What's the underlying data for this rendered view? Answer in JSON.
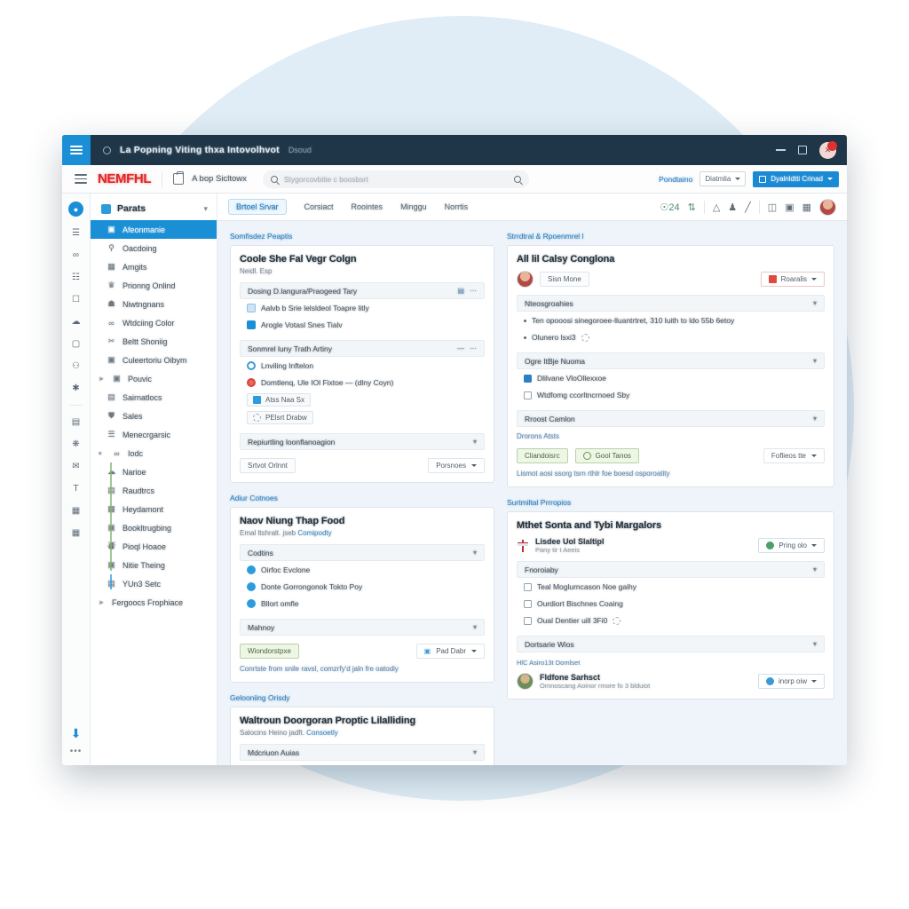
{
  "titlebar": {
    "title": "La Popning Viting thxa Intovolhvot",
    "subtitle": "Dsoud",
    "app_icon": "hamburger-icon",
    "status_icon": "record-circle-icon",
    "minimize": "minimize-icon",
    "maximize": "maximize-icon",
    "close": "close-icon"
  },
  "appbar": {
    "logo": "NEMFHL",
    "menu_icon": "hamburger-icon",
    "briefcase_icon": "briefcase-icon",
    "app_selector_label": "A bop Sicltowx",
    "search": {
      "placeholder": "Stygorcovbitie c boosbsrt",
      "icon": "search-icon"
    },
    "right_link": "Pondtaino",
    "right_select": "Diatmlia",
    "primary_button": "Dyalnldtti Crinad",
    "primary_icon": "save-icon"
  },
  "rail": {
    "top_icon": "user-circle-icon",
    "icons": [
      "list-icon",
      "share-icon",
      "image-icon",
      "inbox-icon",
      "cloud-icon",
      "note-icon",
      "mic-icon",
      "cut-icon"
    ],
    "icons2": [
      "printer-icon",
      "settings-icon",
      "message-icon",
      "text-icon",
      "page-icon",
      "grid-icon"
    ],
    "bottom_icons": [
      "download-icon",
      "more-icon"
    ]
  },
  "sidebar": {
    "header": {
      "label": "Parats",
      "chevron": "chevron-down-icon",
      "icon": "folder-icon"
    },
    "items": [
      {
        "label": "Afeonmanie",
        "icon": "bag-icon",
        "active": true,
        "indent": 1
      },
      {
        "label": "Oacdoing",
        "icon": "search-icon",
        "active": false,
        "indent": 1
      },
      {
        "label": "Amgits",
        "icon": "chart-icon",
        "active": false,
        "indent": 1
      },
      {
        "label": "Prionng Onlind",
        "icon": "award-icon",
        "active": false,
        "indent": 1
      },
      {
        "label": "Niwtngnans",
        "icon": "bank-icon",
        "active": false,
        "indent": 1
      },
      {
        "label": "Wtdciing Color",
        "icon": "share-icon",
        "active": false,
        "indent": 1
      },
      {
        "label": "Beltt Shoniig",
        "icon": "scissors-icon",
        "active": false,
        "indent": 1
      },
      {
        "label": "Culeertoriu Oibym",
        "icon": "image-icon",
        "active": false,
        "indent": 1
      },
      {
        "label": "Pouvic",
        "icon": "calendar-icon",
        "active": false,
        "indent": 0
      },
      {
        "label": "Sairnatlocs",
        "icon": "doc-icon",
        "active": false,
        "indent": 1
      },
      {
        "label": "Sales",
        "icon": "user-icon",
        "active": false,
        "indent": 1
      },
      {
        "label": "Menecrgarsic",
        "icon": "layers-icon",
        "active": false,
        "indent": 1
      }
    ],
    "group": {
      "label": "Iodc",
      "icon": "share-icon",
      "chevron": "chevron-down-icon",
      "children": [
        {
          "label": "Narioe",
          "icon": "globe-icon"
        },
        {
          "label": "Raudtrcs",
          "icon": "book-icon"
        },
        {
          "label": "Heydamont",
          "icon": "table-icon"
        },
        {
          "label": "Bookltrugbing",
          "icon": "note-icon"
        },
        {
          "label": "Pioql Hoaoe",
          "icon": "tag-icon"
        },
        {
          "label": "Nitie Theing",
          "icon": "calendar-icon"
        },
        {
          "label": "YUn3 Setc",
          "icon": "book-icon"
        }
      ]
    },
    "footer_item": {
      "label": "Fergoocs Frophiace",
      "icon": "chevron-right-icon"
    }
  },
  "tabbar": {
    "tabs": [
      {
        "label": "Brtoel Srvar",
        "selected": true
      },
      {
        "label": "Corsiact",
        "selected": false
      },
      {
        "label": "Roointes",
        "selected": false
      },
      {
        "label": "Minggu",
        "selected": false
      },
      {
        "label": "Norrtis",
        "selected": false
      }
    ],
    "tools": [
      "share-count-icon",
      "sync-icon",
      "triangle-icon",
      "person-icon",
      "pencil-icon",
      "crop-icon",
      "export-icon",
      "expand-icon"
    ],
    "avatar": "user-avatar"
  },
  "left_column": [
    {
      "section_title": "Somfisdez Peaptis",
      "title": "Coole She Fal Vegr Colgn",
      "subtitle": "Neidl. Esp",
      "accordion1": {
        "label": "Dosing D.langura/Praogeed Tary",
        "icons": [
          "blue-badge-icon",
          "more-icon"
        ]
      },
      "rows1": [
        {
          "label": "Aalvb b Srie lelsldeol Toapre litly",
          "icon": "square-image-icon"
        },
        {
          "label": "Arogle Votasl Snes Tialv",
          "icon": "square-grid-icon"
        }
      ],
      "accordion2": {
        "label": "Sonmrel luny Trath Artiny",
        "icons": [
          "dash-icon",
          "more-icon"
        ]
      },
      "rows2": [
        {
          "label": "Lnviling Inftelon",
          "icon": "circle-blue-icon"
        },
        {
          "label": "Domtlenq, Ule IOl Fixtoe — (dlny Coyn)",
          "icon": "circle-red-icon"
        }
      ],
      "chips": [
        {
          "label": "Atss Naa Sx",
          "icon": "chart-mini-icon"
        },
        {
          "label": "PElsrt Drabw",
          "icon": "dashed-circle-icon"
        }
      ],
      "accordion3": {
        "label": "Repiurtling loonflanoagion",
        "chevron": "chevron-down-icon"
      },
      "footer": {
        "ghost": "Srtvot Orlnnt",
        "select": "Porsnoes"
      }
    },
    {
      "section_title": "Adiur Cotnoes",
      "title": "Naov Niung Thap Food",
      "subtitle": "Emal ltshralt. jseb",
      "subtitle_link": "Comipodty",
      "accordion1": {
        "label": "Codtins",
        "chevron": "chevron-down-icon"
      },
      "rows1": [
        {
          "label": "Oirfoc Evclone",
          "icon": "check-circle-icon"
        },
        {
          "label": "Donte Gorrongonok Tokto Poy",
          "icon": "check-circle-icon"
        },
        {
          "label": "Bllort omfle",
          "icon": "check-circle-icon"
        }
      ],
      "accordion2": {
        "label": "Mahnoy",
        "chevron": "chevron-down-icon"
      },
      "footer": {
        "green": "Wiondorstpxe",
        "select": "Pad Dabr"
      },
      "note": "Conrtste from snile ravsl, comzrfy'd jaln fre oatodiy"
    },
    {
      "section_title": "Gelooniing Orisdy",
      "title": "Waltroun Doorgoran Proptic Lilalliding",
      "subtitle": "Salocins Heino jadft.",
      "subtitle_link": "Consoetly",
      "accordion1": {
        "label": "Mdcriuon Auias",
        "chevron": "chevron-down-icon"
      }
    }
  ],
  "right_column": [
    {
      "section_title": "Strrdtral & Rpoenmrel l",
      "title": "All lil Calsy Conglona",
      "person": {
        "name": "Sisn Mone",
        "avatar": "user-avatar"
      },
      "person_button": {
        "label": "Roaralis",
        "icon": "red-square-icon",
        "caret": "chevron-down-icon"
      },
      "accordion1": {
        "label": "Nteosgroahies",
        "chevron": "chevron-down-icon"
      },
      "bullets": [
        "Ten opooosi sinegoroee-lluantrtret, 310 luith to ldo 55b 6etoy",
        "Olunero lsxi3"
      ],
      "accordion2": {
        "label": "Ogre ItBje Nuoma",
        "chevron": "chevron-down-icon"
      },
      "checks": [
        {
          "label": "Dlilvane VloOllexxoe",
          "checked": true
        },
        {
          "label": "Wtdfomg ccorltncrnoed Sby",
          "checked": false
        }
      ],
      "accordion3": {
        "label": "Rroost Camlon",
        "chevron": "chevron-down-icon"
      },
      "link": "Drorons Atsts",
      "footer": {
        "green1": "Cliandoisrc",
        "green2": "Gool Tanos",
        "select": "Foflieos tte"
      },
      "note": "Lismot aosi ssorg tsrn rthlr foe boesd osporoatity"
    },
    {
      "section_title": "Surtmiltal Prrropios",
      "title": "Mthet Sonta and Tybi Margalors",
      "person": {
        "name": "Lisdee Uol Slaltipl",
        "sub": "Pany tir t Aeeis",
        "icon": "flag-icon"
      },
      "person_button": {
        "label": "Pring olo",
        "icon": "green-badge-icon",
        "caret": "chevron-down-icon"
      },
      "accordion1": {
        "label": "Fnoroiaby",
        "chevron": "chevron-down-icon"
      },
      "checks": [
        {
          "label": "Teal Moglurncason Noe gaihy",
          "checked": false
        },
        {
          "label": "Ourdiort Bischnes Coaing",
          "checked": false
        },
        {
          "label": "Oual Dentier uill 3Fi0",
          "checked": false
        }
      ],
      "accordion2": {
        "label": "Dortsarie Wios",
        "chevron": "chevron-down-icon"
      },
      "tinylink": "HlC Asiro13t Domlset",
      "contact": {
        "name": "Fldfone Sarhsct",
        "sub": "Omnoscang Aoinor rmore fo 3 blduiot",
        "avatar": "user-avatar"
      },
      "contact_button": {
        "label": "inorp oiw",
        "icon": "blue-badge-icon",
        "caret": "chevron-down-icon"
      }
    }
  ],
  "colors": {
    "accent_blue": "#1b8fd6",
    "titlebar": "#1e3648",
    "logo_red": "#e02626",
    "canvas": "#eef4f9",
    "backdrop_circle": "#dbeaf4",
    "green": "#6f9456"
  }
}
